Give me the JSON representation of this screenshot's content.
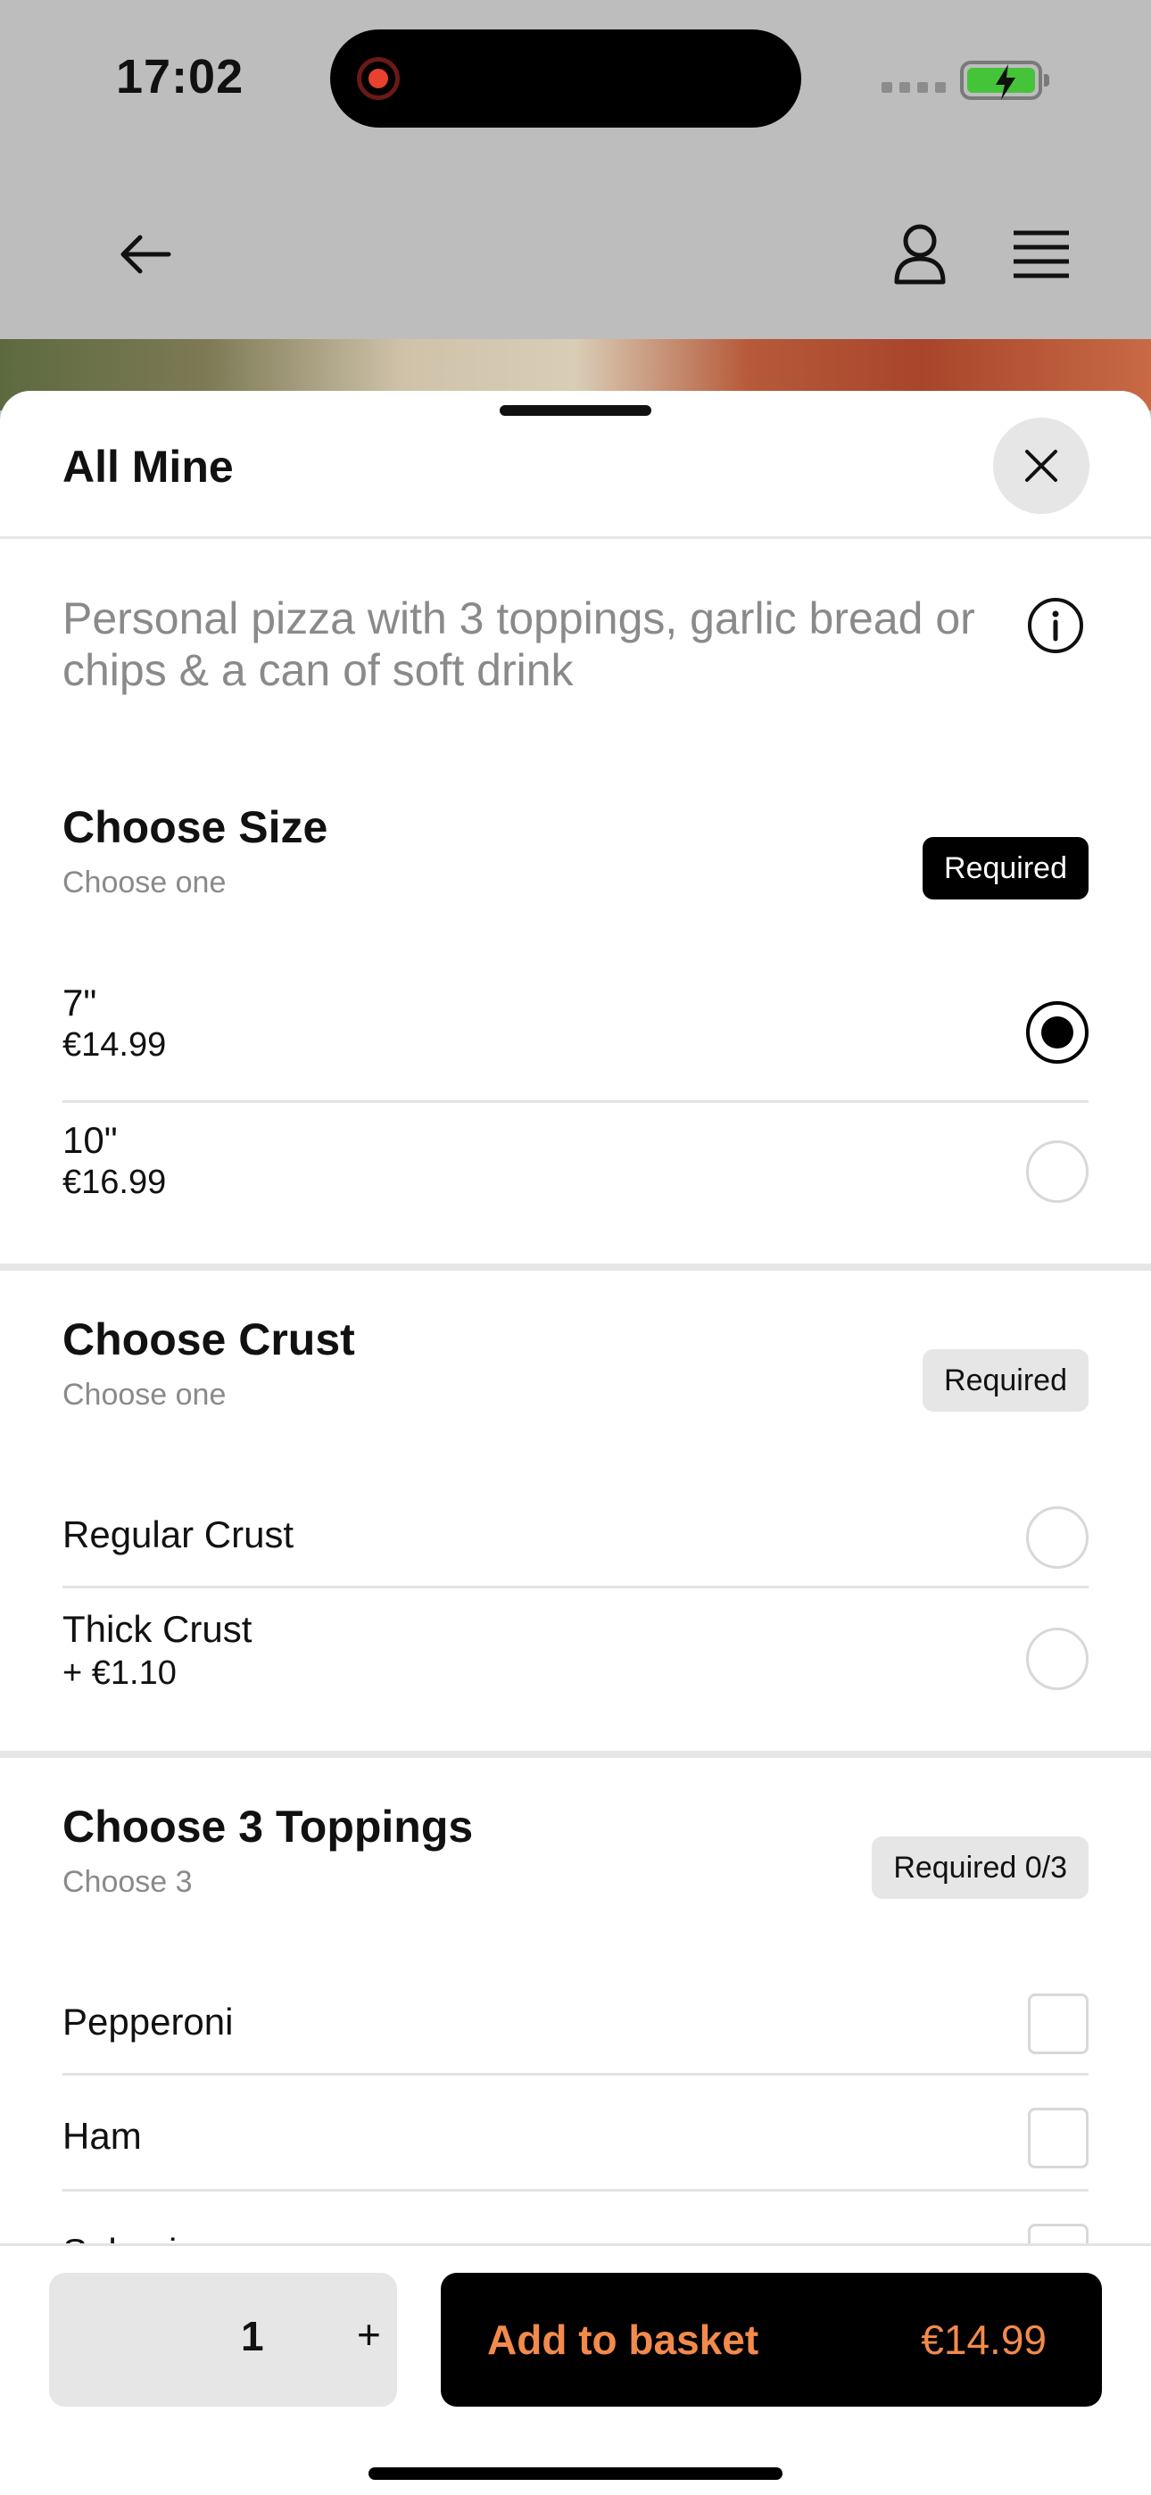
{
  "status_bar": {
    "time": "17:02"
  },
  "header": {
    "back": "back",
    "profile": "profile",
    "menu": "menu"
  },
  "sheet": {
    "title": "All Mine",
    "description": "Personal pizza with 3 toppings, garlic bread or chips & a can of soft drink"
  },
  "sections": [
    {
      "title": "Choose Size",
      "subtitle": "Choose one",
      "badge": "Required",
      "options": [
        {
          "label": "7\"",
          "price": "€14.99",
          "selected": true
        },
        {
          "label": "10\"",
          "price": "€16.99",
          "selected": false
        }
      ]
    },
    {
      "title": "Choose Crust",
      "subtitle": "Choose one",
      "badge": "Required",
      "options": [
        {
          "label": "Regular Crust",
          "price": "",
          "selected": false
        },
        {
          "label": "Thick Crust",
          "price": "+ €1.10",
          "selected": false
        }
      ]
    },
    {
      "title": "Choose 3 Toppings",
      "subtitle": "Choose 3",
      "badge": "Required 0/3",
      "options": [
        {
          "label": "Pepperoni",
          "checked": false
        },
        {
          "label": "Ham",
          "checked": false
        },
        {
          "label": "Salami",
          "checked": false
        }
      ]
    }
  ],
  "footer": {
    "quantity": "1",
    "plus": "+",
    "add_label": "Add to basket",
    "add_price": "€14.99"
  },
  "colors": {
    "accent": "#f28a4b",
    "selected": "#000000",
    "battery": "#45c43a",
    "record": "#e8412f"
  },
  "icons": [
    "back-arrow-icon",
    "profile-icon",
    "menu-icon",
    "close-icon",
    "info-icon",
    "record-icon",
    "battery-icon"
  ]
}
